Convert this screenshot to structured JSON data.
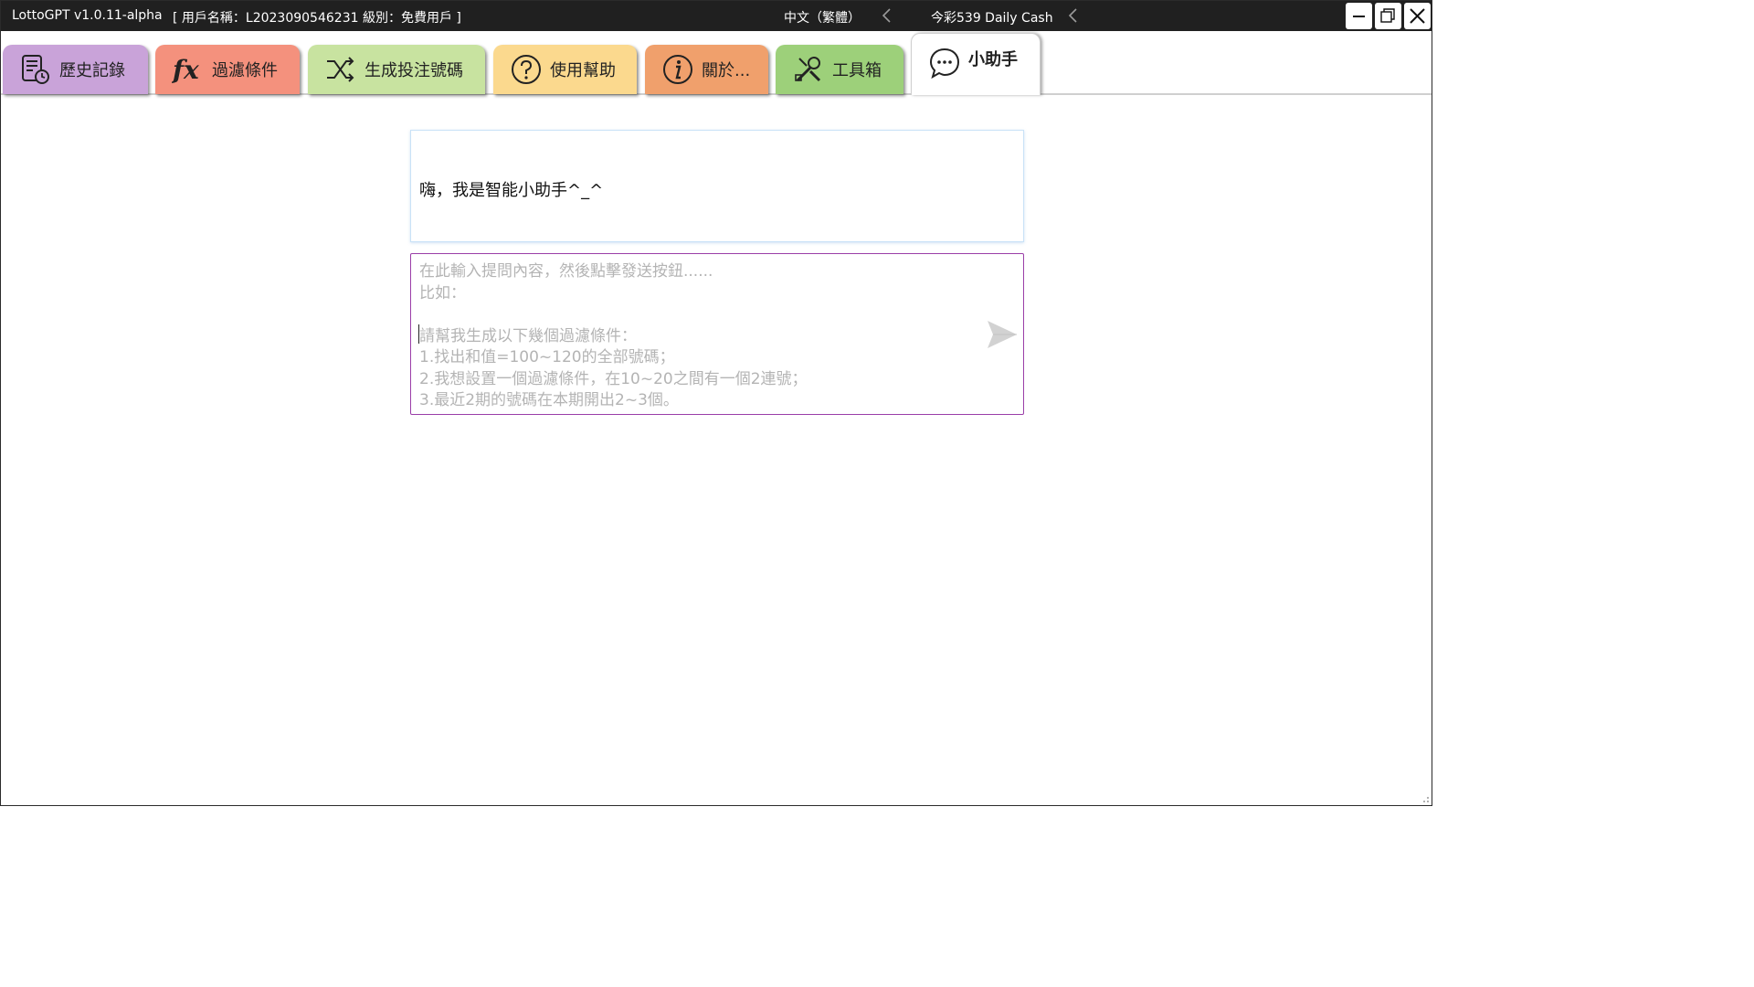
{
  "window": {
    "app_title": "LottoGPT v1.0.11-alpha",
    "user_info": "[ 用戶名稱：L2023090546231  級別：免費用戶 ]",
    "language": "中文（繁體）",
    "lottery": "今彩539 Daily Cash"
  },
  "tabs": [
    {
      "label": "歷史記錄",
      "icon": "history-icon",
      "color": "#c9a3d9"
    },
    {
      "label": "過濾條件",
      "icon": "function-fx-icon",
      "color": "#f4917d"
    },
    {
      "label": "生成投注號碼",
      "icon": "shuffle-icon",
      "color": "#c8e3a0"
    },
    {
      "label": "使用幫助",
      "icon": "question-icon",
      "color": "#fbd98e"
    },
    {
      "label": "關於...",
      "icon": "info-icon",
      "color": "#f0a06c"
    },
    {
      "label": "工具箱",
      "icon": "tools-icon",
      "color": "#9dd07a"
    },
    {
      "label": "小助手",
      "icon": "chat-icon",
      "color": "#ffffff"
    }
  ],
  "assistant": {
    "greeting": "嗨，我是智能小助手^_^",
    "input_placeholder": "在此輸入提問內容，然後點擊發送按鈕......\n比如：\n\n請幫我生成以下幾個過濾條件：\n1.找出和值=100~120的全部號碼；\n2.我想設置一個過濾條件，在10~20之間有一個2連號；\n3.最近2期的號碼在本期開出2~3個。",
    "send_icon": "send-icon"
  }
}
